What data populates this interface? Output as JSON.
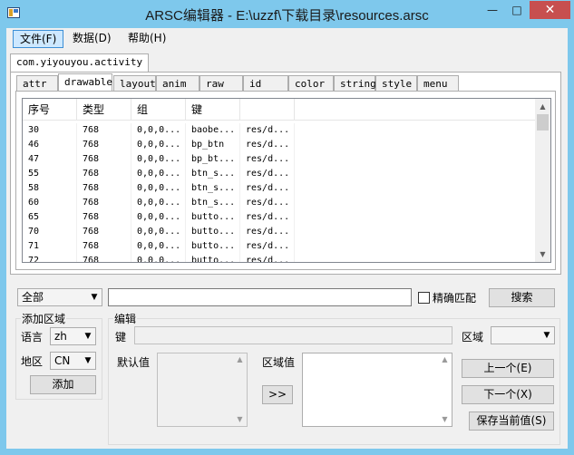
{
  "window": {
    "title": "ARSC编辑器 - E:\\uzzf\\下载目录\\resources.arsc",
    "min_glyph": "—",
    "max_glyph": "□",
    "close_glyph": "✕"
  },
  "menu": {
    "items": [
      "文件(F)",
      "数据(D)",
      "帮助(H)"
    ]
  },
  "package_tab": "com.yiyouyou.activity",
  "type_tabs": [
    "attr",
    "drawable",
    "layout",
    "anim",
    "raw",
    "id",
    "color",
    "string",
    "style",
    "menu"
  ],
  "selected_type_tab": "drawable",
  "grid": {
    "columns": [
      "序号",
      "类型",
      "组",
      "键"
    ],
    "rows": [
      {
        "index": "30",
        "type": "768",
        "group": "0,0,0...",
        "key": "baobe...",
        "value": "res/d..."
      },
      {
        "index": "46",
        "type": "768",
        "group": "0,0,0...",
        "key": "bp_btn",
        "value": "res/d..."
      },
      {
        "index": "47",
        "type": "768",
        "group": "0,0,0...",
        "key": "bp_bt...",
        "value": "res/d..."
      },
      {
        "index": "55",
        "type": "768",
        "group": "0,0,0...",
        "key": "btn_s...",
        "value": "res/d..."
      },
      {
        "index": "58",
        "type": "768",
        "group": "0,0,0...",
        "key": "btn_s...",
        "value": "res/d..."
      },
      {
        "index": "60",
        "type": "768",
        "group": "0,0,0...",
        "key": "btn_s...",
        "value": "res/d..."
      },
      {
        "index": "65",
        "type": "768",
        "group": "0,0,0...",
        "key": "butto...",
        "value": "res/d..."
      },
      {
        "index": "70",
        "type": "768",
        "group": "0,0,0...",
        "key": "butto...",
        "value": "res/d..."
      },
      {
        "index": "71",
        "type": "768",
        "group": "0,0,0...",
        "key": "butto...",
        "value": "res/d..."
      },
      {
        "index": "72",
        "type": "768",
        "group": "0,0,0...",
        "key": "butto...",
        "value": "res/d..."
      }
    ]
  },
  "search": {
    "scope_value": "全部",
    "query": "",
    "exact_match_label": "精确匹配",
    "exact_match_checked": false,
    "search_button": "搜索"
  },
  "add_region": {
    "title": "添加区域",
    "language_label": "语言",
    "language_value": "zh",
    "region_label": "地区",
    "region_value": "CN",
    "add_button": "添加"
  },
  "editor": {
    "title": "编辑",
    "key_label": "键",
    "key_value": "",
    "region_label": "区域",
    "region_value": "",
    "default_value_label": "默认值",
    "region_value_label": "区域值",
    "copy_button": ">>",
    "prev_button": "上一个(E)",
    "next_button": "下一个(X)",
    "save_button": "保存当前值(S)"
  },
  "colors": {
    "title_bar": "#7ec8ec",
    "close_button": "#c74f4f",
    "menu_highlight": "#cde8ff"
  }
}
